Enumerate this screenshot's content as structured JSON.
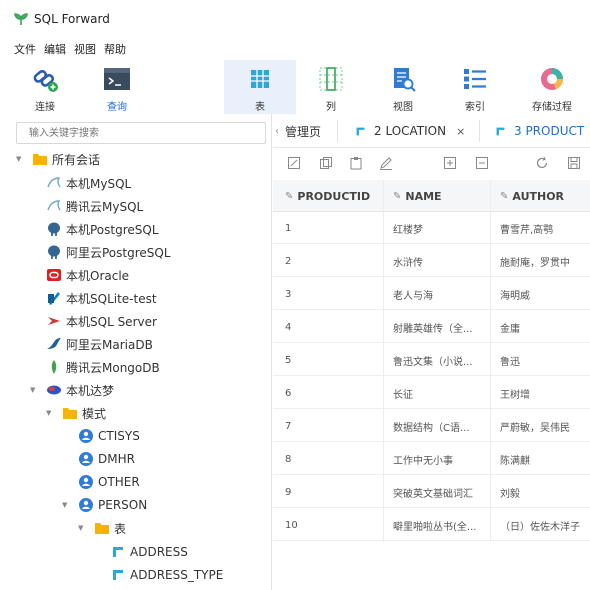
{
  "window": {
    "title": "SQL Forward"
  },
  "menu": [
    "文件",
    "编辑",
    "视图",
    "帮助"
  ],
  "toolbar": [
    {
      "label": "连接",
      "icon": "connect-icon"
    },
    {
      "label": "查询",
      "icon": "query-icon"
    },
    {
      "label": "表",
      "icon": "table-icon",
      "active": true
    },
    {
      "label": "列",
      "icon": "column-icon"
    },
    {
      "label": "视图",
      "icon": "view-icon"
    },
    {
      "label": "索引",
      "icon": "index-icon"
    },
    {
      "label": "存储过程",
      "icon": "procedure-icon"
    }
  ],
  "sidebar": {
    "search_placeholder": "输入关键字搜索",
    "tree": [
      {
        "label": "所有会话",
        "icon": "folder-icon"
      },
      {
        "label": "本机MySQL",
        "icon": "mysql-icon"
      },
      {
        "label": "腾讯云MySQL",
        "icon": "mysql-icon"
      },
      {
        "label": "本机PostgreSQL",
        "icon": "postgresql-icon"
      },
      {
        "label": "阿里云PostgreSQL",
        "icon": "postgresql-icon"
      },
      {
        "label": "本机Oracle",
        "icon": "oracle-icon"
      },
      {
        "label": "本机SQLite-test",
        "icon": "sqlite-icon"
      },
      {
        "label": "本机SQL Server",
        "icon": "sqlserver-icon"
      },
      {
        "label": "阿里云MariaDB",
        "icon": "mariadb-icon"
      },
      {
        "label": "腾讯云MongoDB",
        "icon": "mongodb-icon"
      },
      {
        "label": "本机达梦",
        "icon": "dameng-icon"
      },
      {
        "label": "模式",
        "icon": "folder-icon"
      },
      {
        "label": "CTISYS",
        "icon": "schema-icon"
      },
      {
        "label": "DMHR",
        "icon": "schema-icon"
      },
      {
        "label": "OTHER",
        "icon": "schema-icon"
      },
      {
        "label": "PERSON",
        "icon": "schema-icon"
      },
      {
        "label": "表",
        "icon": "folder-icon"
      },
      {
        "label": "ADDRESS",
        "icon": "table-icon"
      },
      {
        "label": "ADDRESS_TYPE",
        "icon": "table-icon"
      }
    ]
  },
  "tabs": [
    {
      "label": "管理页"
    },
    {
      "label": "2 LOCATION",
      "close": "×"
    },
    {
      "label": "3 PRODUCT"
    }
  ],
  "table": {
    "columns": [
      "PRODUCTID",
      "NAME",
      "AUTHOR"
    ],
    "rows": [
      [
        "1",
        "红楼梦",
        "曹雪芹,高鹗"
      ],
      [
        "2",
        "水浒传",
        "施耐庵，罗贯中"
      ],
      [
        "3",
        "老人与海",
        "海明威"
      ],
      [
        "4",
        "射雕英雄传（全...",
        "金庸"
      ],
      [
        "5",
        "鲁迅文集（小说...",
        "鲁迅"
      ],
      [
        "6",
        "长征",
        "王树增"
      ],
      [
        "7",
        "数据结构（C语...",
        "严蔚敏，吴伟民"
      ],
      [
        "8",
        "工作中无小事",
        "陈满麒"
      ],
      [
        "9",
        "突破英文基础词汇",
        "刘毅"
      ],
      [
        "10",
        "噼里啪啦丛书(全...",
        "（日）佐佐木洋子"
      ]
    ]
  },
  "colors": {
    "accent": "#1b6fd1",
    "folder": "#f5b400",
    "active_bg": "#e8f1fb"
  }
}
